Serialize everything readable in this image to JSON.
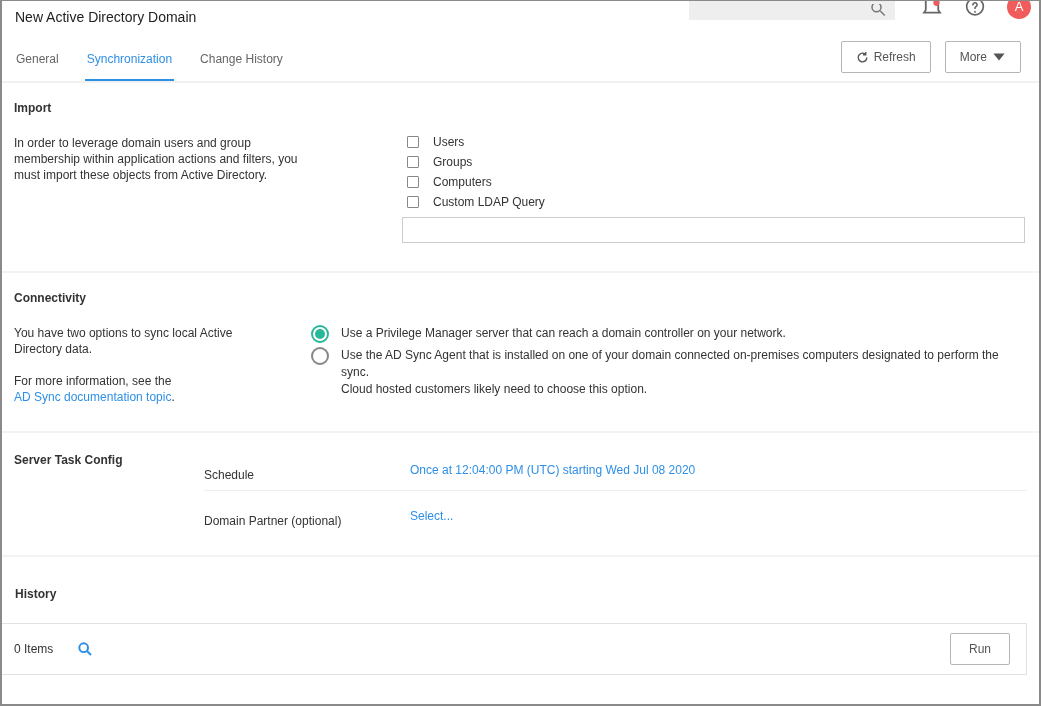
{
  "header": {
    "title": "New Active Directory Domain",
    "avatar": "A"
  },
  "tabs": [
    {
      "label": "General",
      "selected": false
    },
    {
      "label": "Synchronization",
      "selected": true
    },
    {
      "label": "Change History",
      "selected": false
    }
  ],
  "actions": {
    "refresh": "Refresh",
    "more": "More"
  },
  "import": {
    "heading": "Import",
    "description": "In order to leverage domain users and group membership within application actions and filters, you must import these objects from Active Directory.",
    "options": [
      {
        "label": "Users",
        "checked": false
      },
      {
        "label": "Groups",
        "checked": false
      },
      {
        "label": "Computers",
        "checked": false
      },
      {
        "label": "Custom LDAP Query",
        "checked": false
      }
    ]
  },
  "connectivity": {
    "heading": "Connectivity",
    "description": "You have two options to sync local Active Directory data.",
    "info_prefix": "For more information, see the",
    "info_link": "AD Sync documentation topic",
    "info_suffix": ".",
    "options": [
      {
        "label": "Use a Privilege Manager server that can reach a domain controller on your network.",
        "selected": true
      },
      {
        "label": "Use the AD Sync Agent that is installed on one of your domain connected on-premises computers designated to perform the sync.\nCloud hosted customers likely need to choose this option.",
        "selected": false
      }
    ]
  },
  "server_task": {
    "heading": "Server Task Config",
    "rows": [
      {
        "label": "Schedule",
        "value": "Once at 12:04:00 PM (UTC) starting Wed Jul 08 2020"
      },
      {
        "label": "Domain Partner (optional)",
        "value": "Select..."
      }
    ]
  },
  "history": {
    "heading": "History",
    "count": "0 Items",
    "run": "Run"
  }
}
